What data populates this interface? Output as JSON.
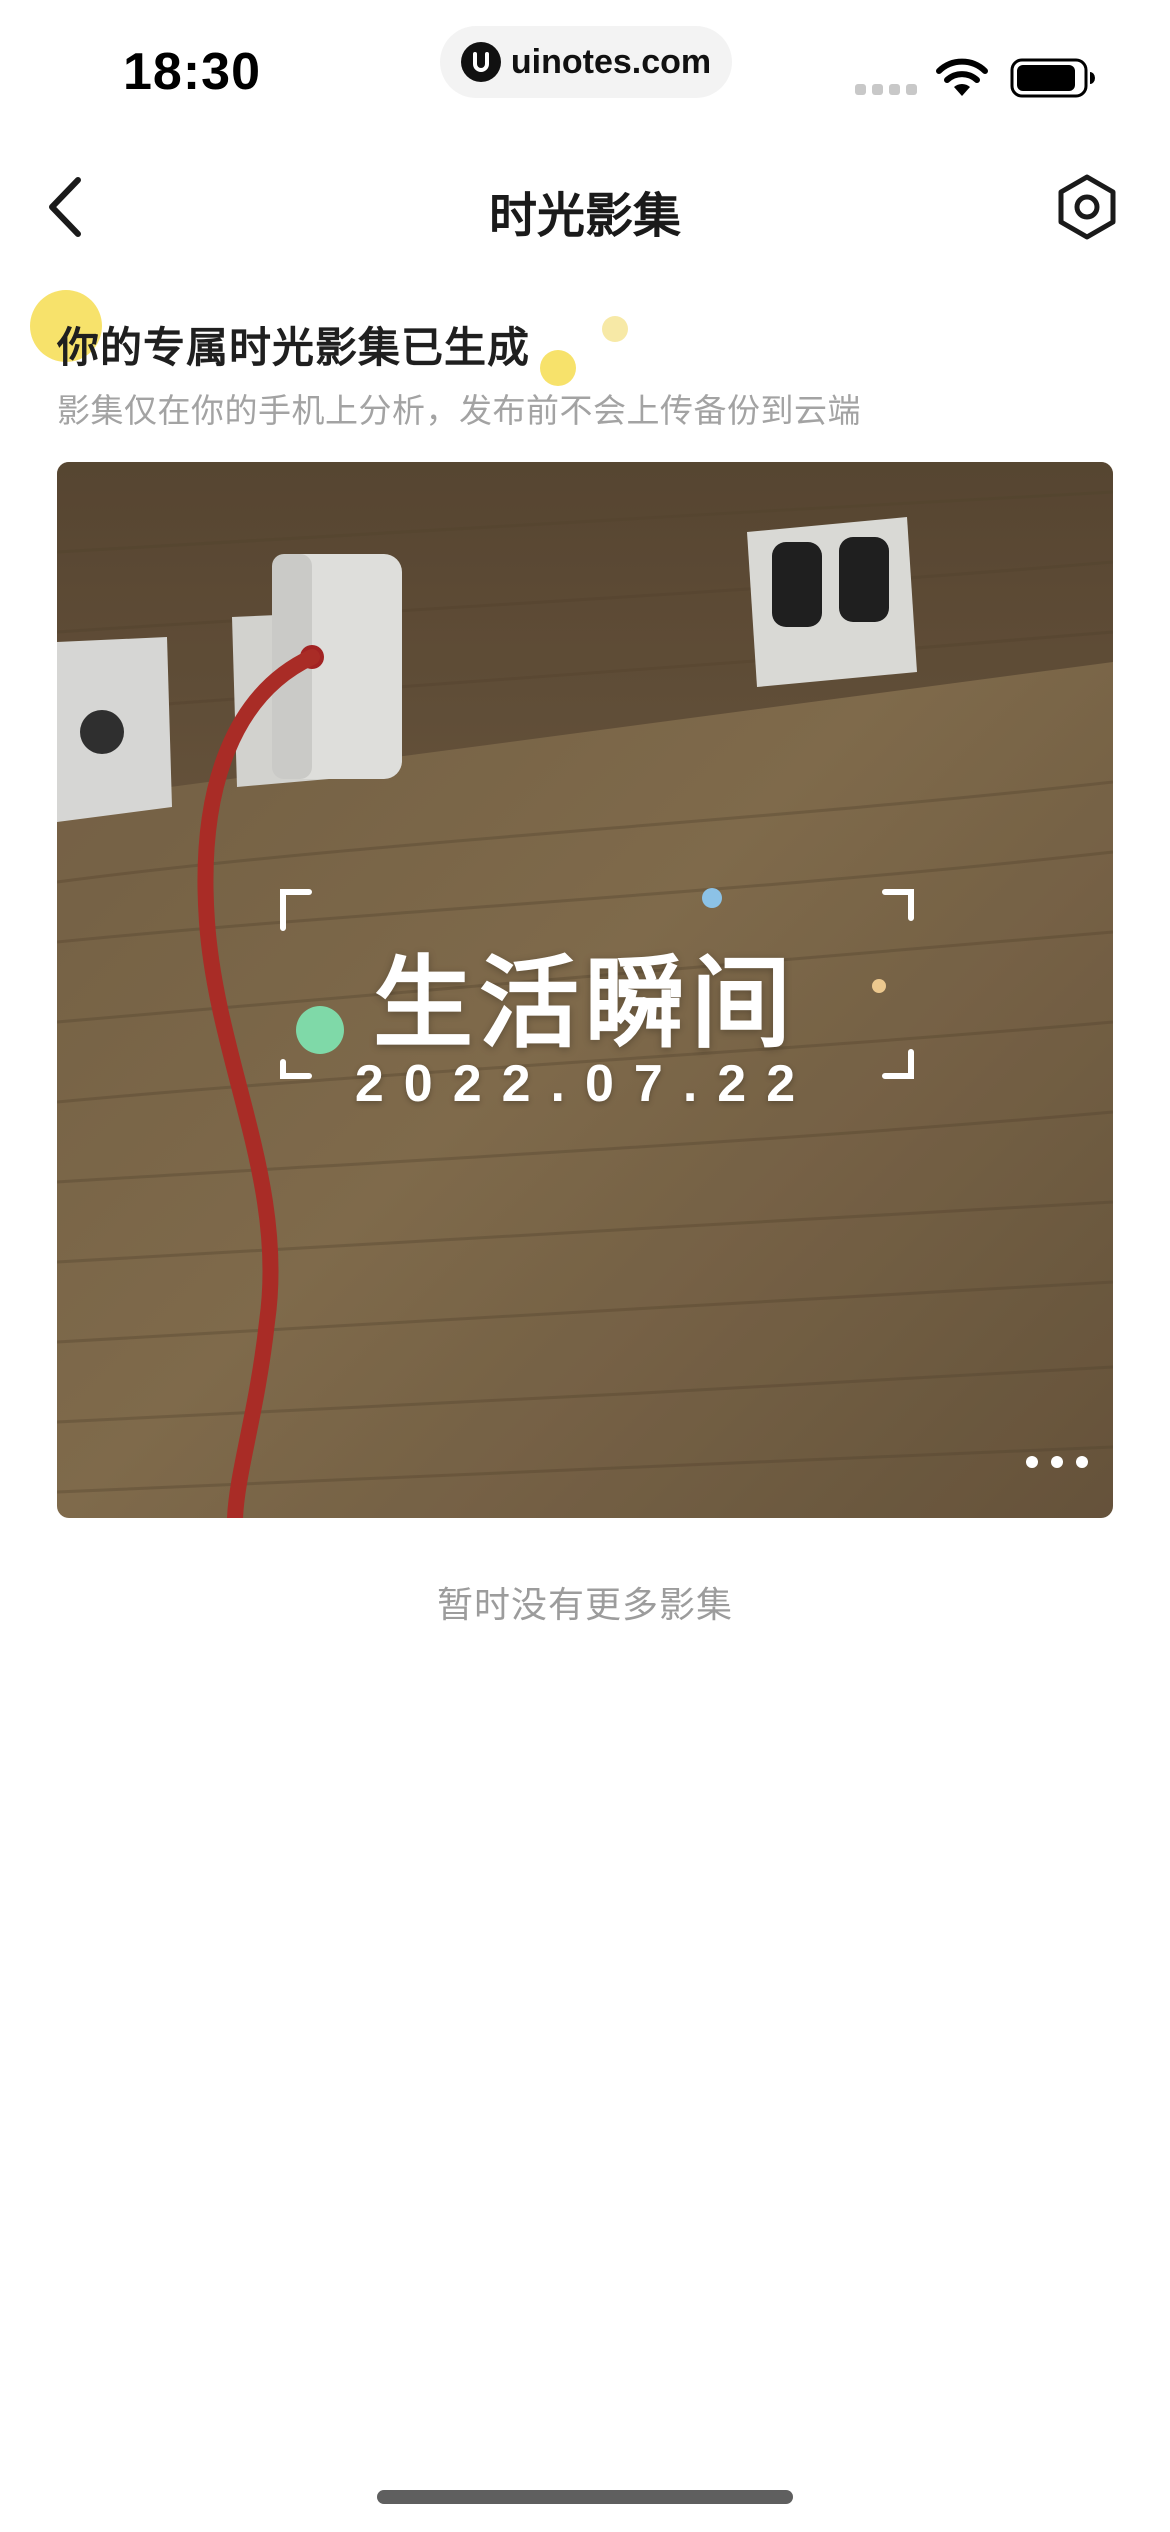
{
  "status_bar": {
    "time": "18:30",
    "url": "uinotes.com",
    "icons": [
      "signal-icon",
      "wifi-icon",
      "battery-icon"
    ]
  },
  "nav": {
    "title": "时光影集",
    "back_icon": "back-chevron-icon",
    "settings_icon": "settings-hexagon-icon"
  },
  "header": {
    "headline": "你的专属时光影集已生成",
    "subtext": "影集仅在你的手机上分析，发布前不会上传备份到云端"
  },
  "album": {
    "title": "生活瞬间",
    "date": "2022.07.22",
    "more_icon": "more-dots-icon"
  },
  "footer": {
    "no_more_text": "暂时没有更多影集"
  },
  "colors": {
    "accent_yellow": "#f7e26b",
    "accent_green": "#7fd9a8",
    "accent_blue": "#8cc2e6",
    "accent_peach": "#ecc88e",
    "text_primary": "#1f1f1f",
    "text_secondary": "#a3a3a3"
  }
}
